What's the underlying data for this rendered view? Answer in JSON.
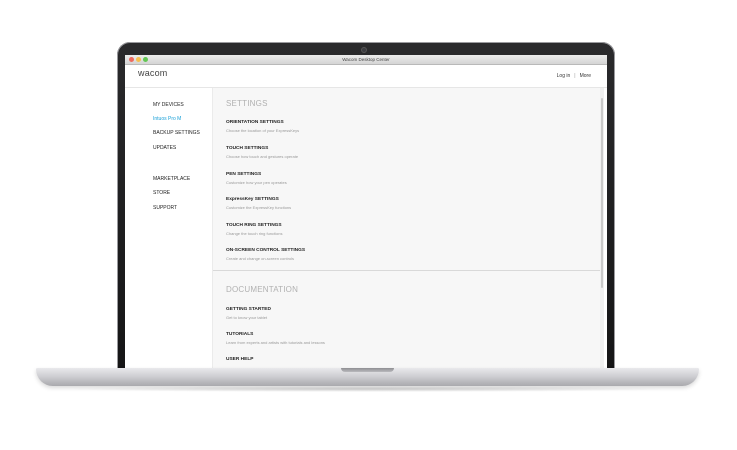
{
  "window": {
    "title": "Wacom Desktop Center"
  },
  "header": {
    "logo": "wacom",
    "login": "Log in",
    "more": "More"
  },
  "sidebar": {
    "items": [
      {
        "label": "MY DEVICES",
        "active": false
      },
      {
        "label": "Intuos Pro M",
        "active": true
      },
      {
        "label": "BACKUP SETTINGS",
        "active": false
      },
      {
        "label": "UPDATES",
        "active": false
      },
      {
        "label": "MARKETPLACE",
        "active": false
      },
      {
        "label": "STORE",
        "active": false
      },
      {
        "label": "SUPPORT",
        "active": false
      }
    ]
  },
  "settings": {
    "title": "SETTINGS",
    "items": [
      {
        "title": "ORIENTATION SETTINGS",
        "desc": "Choose the location of your ExpressKeys"
      },
      {
        "title": "TOUCH SETTINGS",
        "desc": "Choose how touch and gestures operate"
      },
      {
        "title": "PEN SETTINGS",
        "desc": "Customize how your pen operates"
      },
      {
        "title": "ExpressKey SETTINGS",
        "desc": "Customize the ExpressKey functions"
      },
      {
        "title": "TOUCH RING SETTINGS",
        "desc": "Change the touch ring functions"
      },
      {
        "title": "ON-SCREEN CONTROL SETTINGS",
        "desc": "Create and change on-screen controls"
      }
    ]
  },
  "documentation": {
    "title": "DOCUMENTATION",
    "items": [
      {
        "title": "GETTING STARTED",
        "desc": "Get to know your tablet"
      },
      {
        "title": "TUTORIALS",
        "desc": "Learn from experts and artists with tutorials and lessons"
      },
      {
        "title": "USER HELP",
        "desc": ""
      }
    ]
  },
  "colors": {
    "accent": "#1aa0d8",
    "section_title": "#b1b1b1"
  }
}
